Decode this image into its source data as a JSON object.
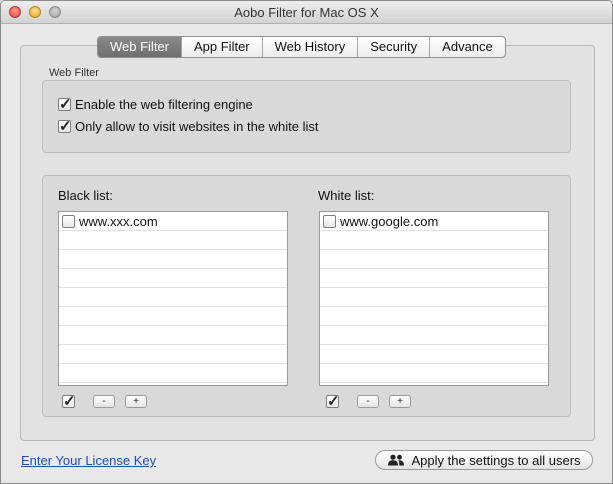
{
  "window": {
    "title": "Aobo Filter for Mac OS X"
  },
  "tabs": [
    {
      "label": "Web Filter",
      "active": true
    },
    {
      "label": "App Filter",
      "active": false
    },
    {
      "label": "Web History",
      "active": false
    },
    {
      "label": "Security",
      "active": false
    },
    {
      "label": "Advance",
      "active": false
    }
  ],
  "web_filter": {
    "group_label": "Web Filter",
    "options": [
      {
        "label": "Enable the web filtering engine",
        "checked": true
      },
      {
        "label": "Only allow to visit websites in the white list",
        "checked": true
      }
    ]
  },
  "black_list": {
    "title": "Black list:",
    "items": [
      {
        "label": "www.xxx.com",
        "checked": false
      }
    ],
    "select_all_checked": true,
    "remove_label": "-",
    "add_label": "+"
  },
  "white_list": {
    "title": "White list:",
    "items": [
      {
        "label": "www.google.com",
        "checked": false
      }
    ],
    "select_all_checked": true,
    "remove_label": "-",
    "add_label": "+"
  },
  "footer": {
    "license_link": "Enter Your License Key",
    "apply_button": "Apply the settings to all users"
  },
  "colors": {
    "link": "#1a4fb5",
    "active_tab": "#7a7a7a"
  },
  "icons": {
    "apply": "users-icon"
  }
}
